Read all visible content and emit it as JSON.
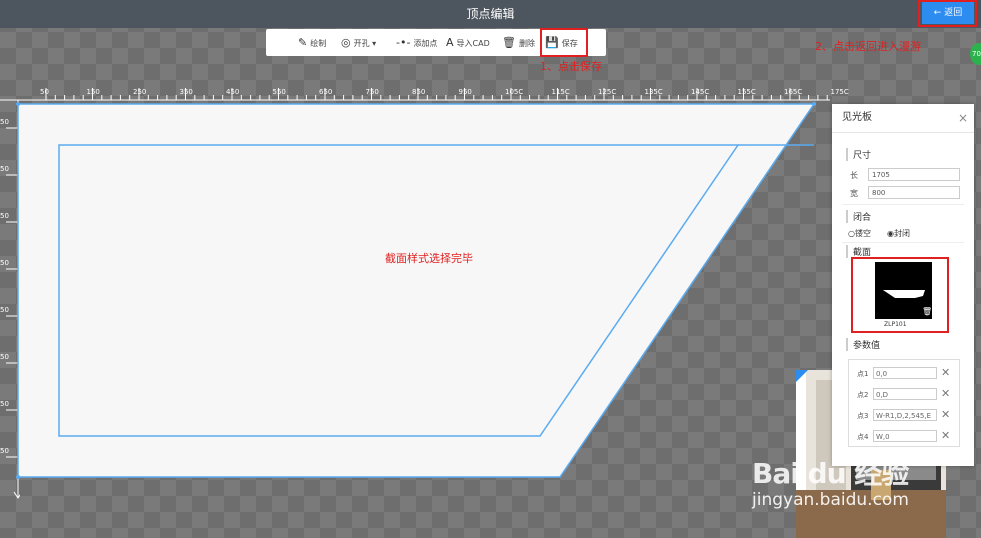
{
  "header": {
    "title": "顶点编辑",
    "back_label": "← 返回"
  },
  "toolbar": {
    "draw": "绘制",
    "hole": "开孔 ▾",
    "add_point": "添加点",
    "import_cad": "导入CAD",
    "delete": "删除",
    "save": "保存"
  },
  "annotations": {
    "step1": "1、点击保存",
    "step2": "2、点击返回进入漫游",
    "center": "截面样式选择完毕"
  },
  "ruler": {
    "top_labels": [
      "50",
      "150",
      "250",
      "350",
      "450",
      "550",
      "650",
      "750",
      "850",
      "950",
      "105C",
      "115C",
      "125C",
      "135C",
      "145C",
      "155C",
      "165C",
      "175C"
    ],
    "left_labels": [
      "50",
      "50",
      "50",
      "50",
      "50",
      "50",
      "50",
      "50"
    ]
  },
  "panel": {
    "title": "见光板",
    "close": "×",
    "size_label": "尺寸",
    "length_label": "长",
    "length_value": "1705",
    "width_label": "宽",
    "width_value": "800",
    "closure_label": "闭合",
    "open_option": "镂空",
    "closed_option": "封闭",
    "section_label": "截面",
    "section_name": "ZLP101",
    "params_label": "参数值",
    "params": [
      {
        "label": "点1",
        "value": "0,0"
      },
      {
        "label": "点2",
        "value": "0,D"
      },
      {
        "label": "点3",
        "value": "W-R1,D,2,545,E"
      },
      {
        "label": "点4",
        "value": "W,0"
      }
    ]
  },
  "watermark": {
    "line1": "Bai du 经验",
    "line2": "jingyan.baidu.com"
  },
  "misc": {
    "green_badge": "70"
  },
  "colors": {
    "accent": "#2d8cf0",
    "highlight": "#e02020",
    "shape_stroke": "#5aabf0",
    "titlebar": "#4d555e"
  }
}
